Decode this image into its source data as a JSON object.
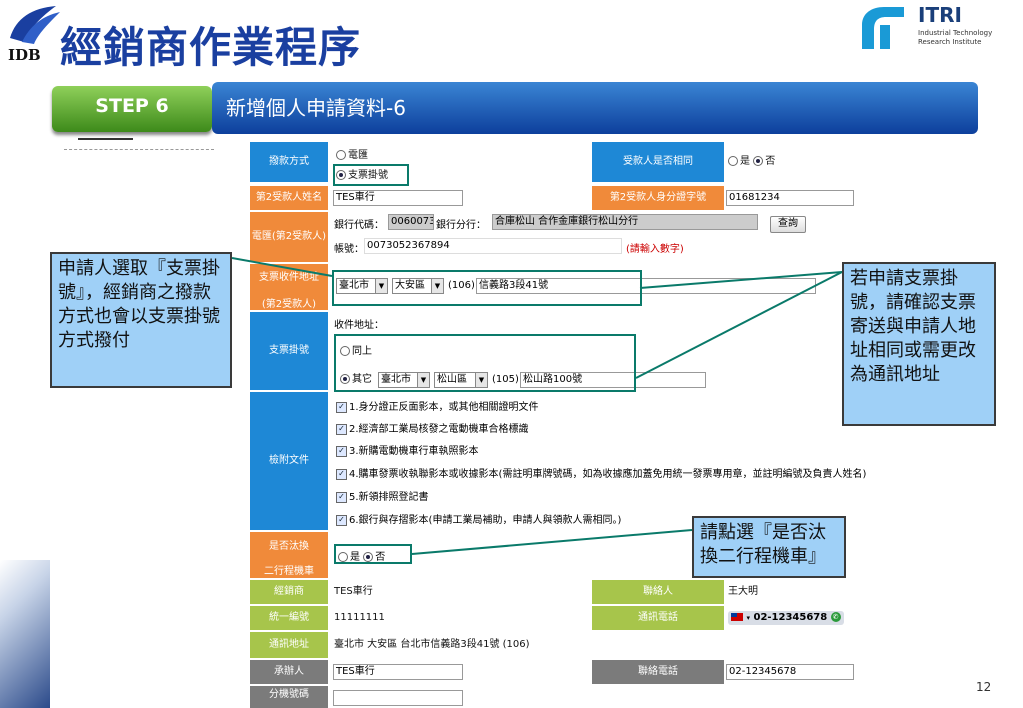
{
  "header": {
    "logo_text": "IDB",
    "title": "經銷商作業程序",
    "itri_name": "ITRI",
    "itri_sub1": "Industrial Technology",
    "itri_sub2": "Research Institute",
    "step_label": "STEP 6",
    "bar_title": "新增個人申請資料-6"
  },
  "form": {
    "payment_label": "撥款方式",
    "payment_opt1": "電匯",
    "payment_opt2": "支票掛號",
    "same_payee_label": "受款人是否相同",
    "yes": "是",
    "no": "否",
    "payee2_name_label": "第2受款人姓名",
    "payee2_name_value": "TES車行",
    "payee2_id_label": "第2受款人身分證字號",
    "payee2_id_value": "01681234",
    "wire_label": "電匯(第2受款人)",
    "bank_code_label": "銀行代碼：",
    "bank_code_value": "0060073",
    "bank_branch_label": "銀行分行：",
    "bank_branch_value": "合庫松山  合作金庫銀行松山分行",
    "query_button": "查詢",
    "account_label": "帳號：",
    "account_value": "0073052367894",
    "account_hint": "(請輸入數字)",
    "cheque_addr_label1": "支票收件地址",
    "cheque_addr_label2": "(第2受款人)",
    "city1": "臺北市",
    "district1": "大安區",
    "zip1": "(106)",
    "street1": "信義路3段41號",
    "cheque_label": "支票掛號",
    "recv_addr_label": "收件地址：",
    "same_above": "同上",
    "other": "其它",
    "city2": "臺北市",
    "district2": "松山區",
    "zip2": "(105)",
    "street2": "松山路100號",
    "attach_label": "檢附文件",
    "docs": [
      "1.身分證正反面影本，或其他相關證明文件",
      "2.經濟部工業局核發之電動機車合格標識",
      "3.新購電動機車行車執照影本",
      "4.購車發票收執聯影本或收據影本(需註明車牌號碼，如為收據應加蓋免用統一發票專用章，並註明編號及負責人姓名)",
      "5.新領排照登記書",
      "6.銀行與存摺影本(申請工業局補助，申請人與領款人需相同。)"
    ],
    "replace_label1": "是否汰換",
    "replace_label2": "二行程機車",
    "dealer_label": "經銷商",
    "dealer_value": "TES車行",
    "contact_label": "聯絡人",
    "contact_value": "王大明",
    "taxid_label": "統一編號",
    "taxid_value": "11111111",
    "phone_label": "通訊電話",
    "phone_value": "02-12345678",
    "addr_label": "通訊地址",
    "addr_value": "臺北市 大安區 台北市信義路3段41號 (106)",
    "handler_label": "承辦人",
    "handler_value": "TES車行",
    "handler_phone_label": "聯絡電話",
    "handler_phone_value": "02-12345678",
    "branch_label": "分機號碼"
  },
  "callouts": {
    "left": "申請人選取『支票掛號』，經銷商之撥款方式也會以支票掛號方式撥付",
    "right": "若申請支票掛號，請確認支票寄送與申請人地址相同或需更改為通訊地址",
    "bottom": "請點選『是否汰換二行程機車』"
  },
  "page_number": "12"
}
